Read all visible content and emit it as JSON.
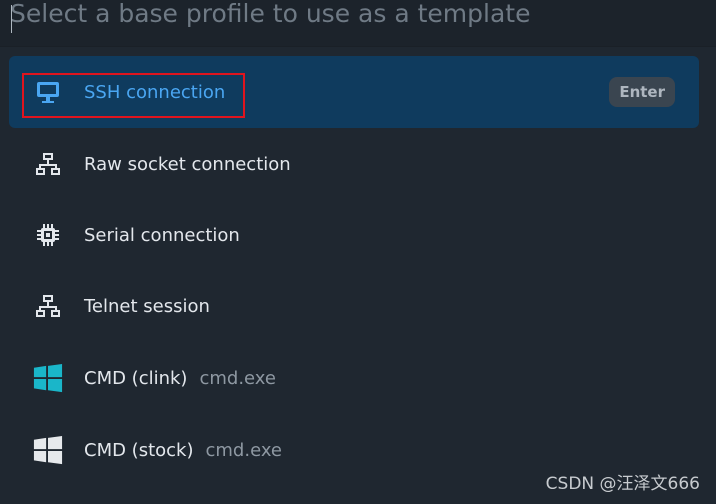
{
  "search": {
    "placeholder": "Select a base profile to use as a template",
    "value": ""
  },
  "profiles": [
    {
      "label": "SSH connection",
      "sub": "",
      "icon": "monitor-icon",
      "selected": true,
      "shortcut": "Enter"
    },
    {
      "label": "Raw socket connection",
      "sub": "",
      "icon": "network-icon",
      "selected": false,
      "shortcut": ""
    },
    {
      "label": "Serial connection",
      "sub": "",
      "icon": "chip-icon",
      "selected": false,
      "shortcut": ""
    },
    {
      "label": "Telnet session",
      "sub": "",
      "icon": "network-icon",
      "selected": false,
      "shortcut": ""
    },
    {
      "label": "CMD (clink)",
      "sub": "cmd.exe",
      "icon": "windows-icon",
      "selected": false,
      "shortcut": ""
    },
    {
      "label": "CMD (stock)",
      "sub": "cmd.exe",
      "icon": "windows-icon",
      "selected": false,
      "shortcut": ""
    }
  ],
  "watermark": "CSDN @汪泽文666",
  "colors": {
    "background": "#1f2730",
    "selected_row": "#0f3b5e",
    "selected_text": "#4aa6f2",
    "highlight_box": "#e0141e",
    "windows_clink": "#1ab6c9",
    "windows_stock": "#e6e9ec"
  }
}
